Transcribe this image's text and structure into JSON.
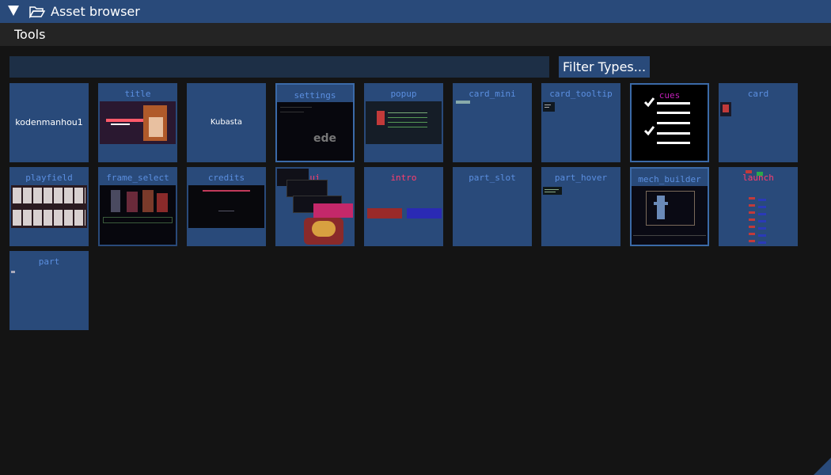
{
  "window": {
    "title": "Asset browser"
  },
  "menu": {
    "tools": "Tools"
  },
  "search": {
    "value": "",
    "placeholder": ""
  },
  "filter_button": "Filter Types...",
  "tiles": [
    {
      "name": "kodenmanhou1",
      "center_text": "kodenmanhou1"
    },
    {
      "name": "title"
    },
    {
      "name": "Kubasta",
      "center_text": "Kubasta"
    },
    {
      "name": "settings"
    },
    {
      "name": "popup"
    },
    {
      "name": "card_mini"
    },
    {
      "name": "card_tooltip"
    },
    {
      "name": "cues"
    },
    {
      "name": "card"
    },
    {
      "name": "playfield"
    },
    {
      "name": "frame_select"
    },
    {
      "name": "credits"
    },
    {
      "name": "ui"
    },
    {
      "name": "intro"
    },
    {
      "name": "part_slot"
    },
    {
      "name": "part_hover"
    },
    {
      "name": "mech_builder"
    },
    {
      "name": "launch"
    },
    {
      "name": "part"
    }
  ],
  "colors": {
    "accent": "#294a7a",
    "background": "#141414",
    "tile_label": "#5b8fe0"
  }
}
